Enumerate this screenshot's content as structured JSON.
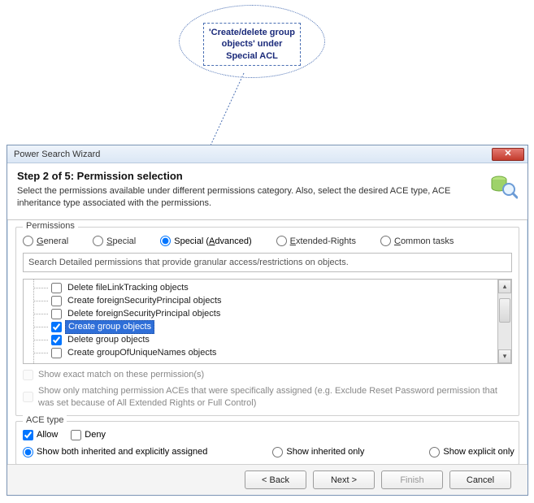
{
  "callout": {
    "line1": "'Create/delete group",
    "line2": "objects' under",
    "line3": "Special ACL"
  },
  "window": {
    "title": "Power Search Wizard"
  },
  "header": {
    "step_title": "Step 2 of 5:  Permission selection",
    "subtitle": "Select the permissions available under different permissions category. Also, select the desired ACE type, ACE inheritance type associated with the permissions."
  },
  "permissions": {
    "legend": "Permissions",
    "radios": {
      "general": {
        "label": "General",
        "mnemonic": "G"
      },
      "special": {
        "label": "Special",
        "mnemonic": "S"
      },
      "special_adv": {
        "label": "Special (Advanced)",
        "mnemonic": "A"
      },
      "extended": {
        "label": "Extended-Rights",
        "mnemonic": "E"
      },
      "common": {
        "label": "Common tasks",
        "mnemonic": "C"
      },
      "selected": "special_adv"
    },
    "search_placeholder": "Search Detailed permissions that provide granular access/restrictions on objects.",
    "tree": [
      {
        "label": "Delete fileLinkTracking objects",
        "checked": false,
        "selected": false
      },
      {
        "label": "Create foreignSecurityPrincipal objects",
        "checked": false,
        "selected": false
      },
      {
        "label": "Delete foreignSecurityPrincipal objects",
        "checked": false,
        "selected": false
      },
      {
        "label": "Create group objects",
        "checked": true,
        "selected": true
      },
      {
        "label": "Delete group objects",
        "checked": true,
        "selected": false
      },
      {
        "label": "Create groupOfUniqueNames objects",
        "checked": false,
        "selected": false
      }
    ],
    "opt_exact": "Show exact match on these permission(s)",
    "opt_matching": "Show only matching permission ACEs that were specifically assigned (e.g. Exclude Reset Password permission that was set because of All Extended Rights or Full Control)"
  },
  "ace": {
    "legend": "ACE type",
    "allow_label": "Allow",
    "deny_label": "Deny",
    "allow_checked": true,
    "deny_checked": false,
    "show_both": "Show both inherited and explicitly assigned",
    "show_inherited": "Show inherited only",
    "show_explicit": "Show explicit only",
    "inherit_selected": "both"
  },
  "buttons": {
    "back": "< Back",
    "next": "Next >",
    "finish": "Finish",
    "cancel": "Cancel"
  }
}
